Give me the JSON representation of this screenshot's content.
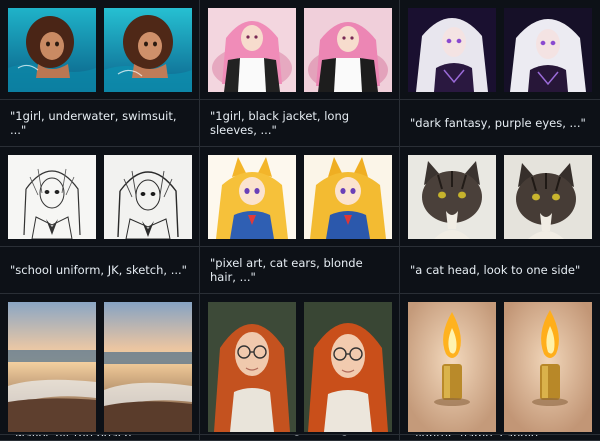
{
  "cells": [
    {
      "caption": "\"1girl, underwater, swimsuit, ...\"",
      "left_image": "underwater-girl-original",
      "right_image": "underwater-girl-result"
    },
    {
      "caption": "\"1girl, black jacket, long sleeves, ...\"",
      "left_image": "pink-hair-girl-original",
      "right_image": "pink-hair-girl-result"
    },
    {
      "caption": "\"dark fantasy, purple eyes, ...\"",
      "left_image": "white-hair-girl-original",
      "right_image": "white-hair-girl-result"
    },
    {
      "caption": "\"school uniform, JK, sketch, ...\"",
      "left_image": "sketch-girl-original",
      "right_image": "sketch-girl-result"
    },
    {
      "caption": "\"pixel art, cat ears, blonde hair, ...\"",
      "left_image": "blonde-cat-ear-girl-original",
      "right_image": "blonde-cat-ear-girl-result"
    },
    {
      "caption": "\"a cat head, look to one side\"",
      "left_image": "tabby-cat-original",
      "right_image": "tabby-cat-result"
    },
    {
      "caption": "\"waves hit the beach\"",
      "left_image": "beach-waves-original",
      "right_image": "beach-waves-result"
    },
    {
      "caption": "\"freckles, orange hair, glasses, ...\"",
      "left_image": "redhead-glasses-original",
      "right_image": "redhead-glasses-result"
    },
    {
      "caption": "\"lighter, flame, candle\"",
      "left_image": "candle-flame-original",
      "right_image": "candle-flame-result"
    }
  ],
  "colors": {
    "background": "#0d1117",
    "grid_line": "#2a2f36",
    "caption_text": "#e6edf3"
  }
}
